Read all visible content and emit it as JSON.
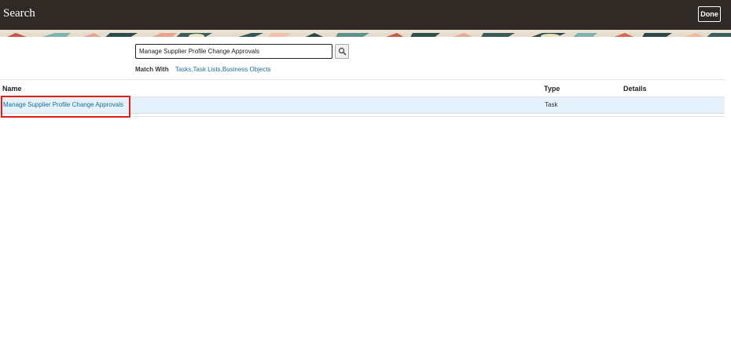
{
  "header": {
    "title": "Search",
    "done_label": "Done"
  },
  "search": {
    "value": "Manage Supplier Profile Change Approvals",
    "button_icon": "search-icon"
  },
  "match_with": {
    "label": "Match With",
    "values": "Tasks,Task Lists,Business Objects"
  },
  "results": {
    "columns": {
      "name": "Name",
      "type": "Type",
      "details": "Details"
    },
    "rows": [
      {
        "name": "Manage Supplier Profile Change Approvals",
        "type": "Task",
        "details": ""
      }
    ]
  },
  "colors": {
    "header_bg": "#2f2a26",
    "link": "#1d6d96",
    "selected_row": "#e5f1fb",
    "highlight": "#e0201b"
  }
}
